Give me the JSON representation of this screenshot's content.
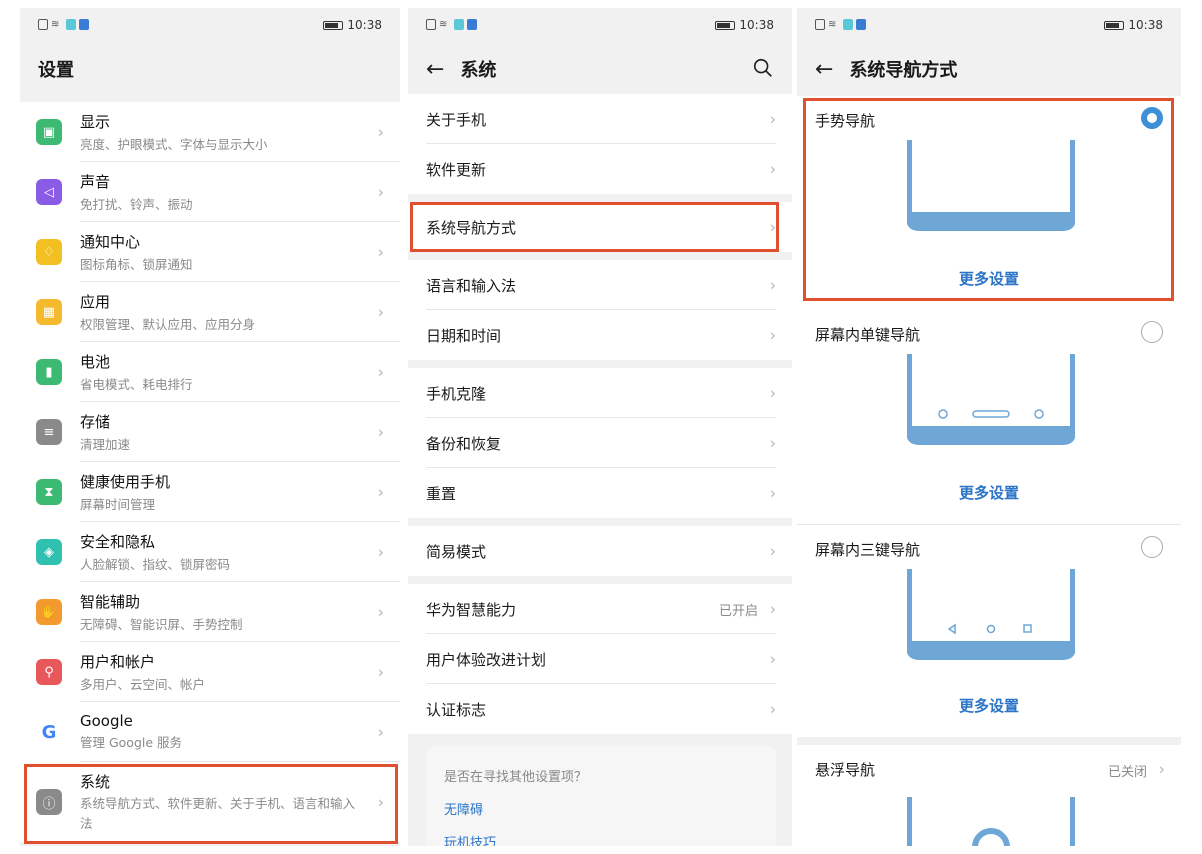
{
  "status": {
    "time": "10:38"
  },
  "screen1": {
    "title": "设置",
    "items": [
      {
        "title": "显示",
        "sub": "亮度、护眼模式、字体与显示大小",
        "icon": "display-icon",
        "color": "#3cb972"
      },
      {
        "title": "声音",
        "sub": "免打扰、铃声、振动",
        "icon": "sound-icon",
        "color": "#8a5ce6"
      },
      {
        "title": "通知中心",
        "sub": "图标角标、锁屏通知",
        "icon": "bell-icon",
        "color": "#f2c020"
      },
      {
        "title": "应用",
        "sub": "权限管理、默认应用、应用分身",
        "icon": "apps-icon",
        "color": "#f5b92e"
      },
      {
        "title": "电池",
        "sub": "省电模式、耗电排行",
        "icon": "battery-icon",
        "color": "#3cb972"
      },
      {
        "title": "存储",
        "sub": "清理加速",
        "icon": "storage-icon",
        "color": "#8a8a8a"
      },
      {
        "title": "健康使用手机",
        "sub": "屏幕时间管理",
        "icon": "hourglass-icon",
        "color": "#3cb972"
      },
      {
        "title": "安全和隐私",
        "sub": "人脸解锁、指纹、锁屏密码",
        "icon": "shield-icon",
        "color": "#30c0b0"
      },
      {
        "title": "智能辅助",
        "sub": "无障碍、智能识屏、手势控制",
        "icon": "hand-icon",
        "color": "#f29a2e"
      },
      {
        "title": "用户和帐户",
        "sub": "多用户、云空间、帐户",
        "icon": "user-icon",
        "color": "#e8575a"
      },
      {
        "title": "Google",
        "sub": "管理 Google 服务",
        "icon": "google-icon",
        "color": "#ffffff"
      },
      {
        "title": "系统",
        "sub": "系统导航方式、软件更新、关于手机、语言和输入法",
        "icon": "system-icon",
        "color": "#8a8a8a"
      }
    ]
  },
  "screen2": {
    "title": "系统",
    "groups": [
      [
        {
          "label": "关于手机"
        },
        {
          "label": "软件更新"
        }
      ],
      [
        {
          "label": "系统导航方式"
        }
      ],
      [
        {
          "label": "语言和输入法"
        },
        {
          "label": "日期和时间"
        }
      ],
      [
        {
          "label": "手机克隆"
        },
        {
          "label": "备份和恢复"
        },
        {
          "label": "重置"
        }
      ],
      [
        {
          "label": "简易模式"
        }
      ],
      [
        {
          "label": "华为智慧能力",
          "value": "已开启"
        },
        {
          "label": "用户体验改进计划"
        },
        {
          "label": "认证标志"
        }
      ]
    ],
    "find": {
      "question": "是否在寻找其他设置项？",
      "links": [
        "无障碍",
        "玩机技巧"
      ]
    }
  },
  "screen3": {
    "title": "系统导航方式",
    "options": [
      {
        "name": "手势导航",
        "selected": true,
        "more": "更多设置"
      },
      {
        "name": "屏幕内单键导航",
        "selected": false,
        "more": "更多设置"
      },
      {
        "name": "屏幕内三键导航",
        "selected": false,
        "more": "更多设置"
      },
      {
        "name": "悬浮导航",
        "value": "已关闭"
      }
    ]
  },
  "colors": {
    "accent": "#2b74c7",
    "highlight": "#e0502e",
    "phone": "#6ea6d6"
  }
}
